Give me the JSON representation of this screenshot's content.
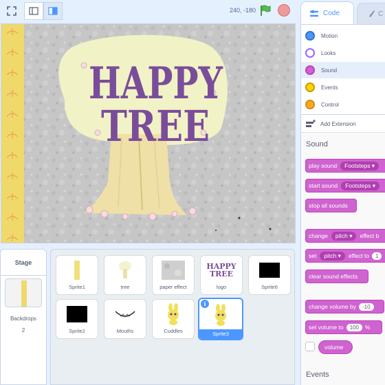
{
  "toolbar": {
    "coords": "240, -180",
    "fullscreen_icon": "fullscreen-icon",
    "small_stage_icon": "small-stage-icon",
    "large_stage_icon": "large-stage-icon"
  },
  "stage": {
    "title_line1": "HAPPY",
    "title_line2": "TREE"
  },
  "stage_panel": {
    "title": "Stage",
    "backdrops_label": "Backdrops",
    "backdrops_count": "2"
  },
  "sprites": [
    {
      "name": "Sprite1",
      "selected": false
    },
    {
      "name": "tree",
      "selected": false
    },
    {
      "name": "paper effect",
      "selected": false
    },
    {
      "name": "logo",
      "selected": false
    },
    {
      "name": "Sprite6",
      "selected": false
    },
    {
      "name": "Sprite2",
      "selected": false
    },
    {
      "name": "Mouths",
      "selected": false
    },
    {
      "name": "Cuddles",
      "selected": false
    },
    {
      "name": "Sprite3",
      "selected": true
    }
  ],
  "logo_thumb": {
    "line1": "HAPPY",
    "line2": "TREE"
  },
  "tabs": {
    "code": "Code",
    "costumes": "C"
  },
  "categories": [
    {
      "label": "Motion",
      "color": "#4c97ff"
    },
    {
      "label": "Looks",
      "color": "#9966ff"
    },
    {
      "label": "Sound",
      "color": "#cf63cf"
    },
    {
      "label": "Events",
      "color": "#ffbf00"
    },
    {
      "label": "Control",
      "color": "#ffab19"
    }
  ],
  "extension_label": "Add Extension",
  "palette": {
    "sound_title": "Sound",
    "events_title": "Events",
    "blocks": {
      "play_sound": "play sound",
      "play_sound_arg": "Footsteps ▾",
      "start_sound": "start sound",
      "start_sound_arg": "Footsteps ▾",
      "stop_all": "stop all sounds",
      "change_pitch_a": "change",
      "change_pitch_chip": "pitch ▾",
      "change_pitch_b": "effect b",
      "set_pitch_a": "set",
      "set_pitch_chip": "pitch ▾",
      "set_pitch_b": "effect to",
      "set_pitch_val": "1",
      "clear_effects": "clear sound effects",
      "change_volume_a": "change volume by",
      "change_volume_val": "-10",
      "set_volume_a": "set volume to",
      "set_volume_val": "100",
      "set_volume_b": "%",
      "volume": "volume"
    }
  }
}
